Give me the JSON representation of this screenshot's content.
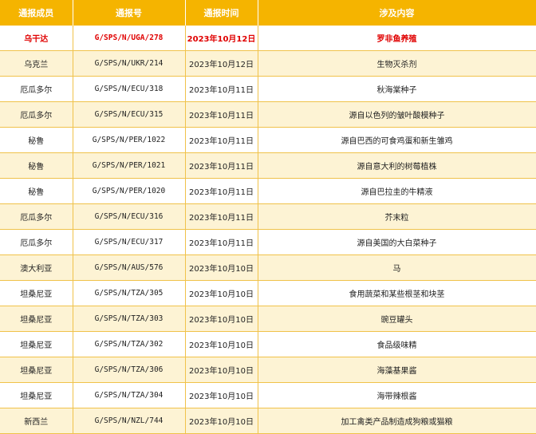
{
  "header": {
    "member": "通报成员",
    "number": "通报号",
    "time": "通报时间",
    "content": "涉及内容"
  },
  "rows": [
    {
      "member": "乌干达",
      "number": "G/SPS/N/UGA/278",
      "time": "2023年10月12日",
      "content": "罗非鱼养殖"
    },
    {
      "member": "乌克兰",
      "number": "G/SPS/N/UKR/214",
      "time": "2023年10月12日",
      "content": "生物灭杀剂"
    },
    {
      "member": "厄瓜多尔",
      "number": "G/SPS/N/ECU/318",
      "time": "2023年10月11日",
      "content": "秋海棠种子"
    },
    {
      "member": "厄瓜多尔",
      "number": "G/SPS/N/ECU/315",
      "time": "2023年10月11日",
      "content": "源自以色列的皱叶酸模种子"
    },
    {
      "member": "秘鲁",
      "number": "G/SPS/N/PER/1022",
      "time": "2023年10月11日",
      "content": "源自巴西的可食鸡蛋和新生雏鸡"
    },
    {
      "member": "秘鲁",
      "number": "G/SPS/N/PER/1021",
      "time": "2023年10月11日",
      "content": "源自意大利的树莓植株"
    },
    {
      "member": "秘鲁",
      "number": "G/SPS/N/PER/1020",
      "time": "2023年10月11日",
      "content": "源自巴拉圭的牛精液"
    },
    {
      "member": "厄瓜多尔",
      "number": "G/SPS/N/ECU/316",
      "time": "2023年10月11日",
      "content": "芥末粒"
    },
    {
      "member": "厄瓜多尔",
      "number": "G/SPS/N/ECU/317",
      "time": "2023年10月11日",
      "content": "源自美国的大白菜种子"
    },
    {
      "member": "澳大利亚",
      "number": "G/SPS/N/AUS/576",
      "time": "2023年10月10日",
      "content": "马"
    },
    {
      "member": "坦桑尼亚",
      "number": "G/SPS/N/TZA/305",
      "time": "2023年10月10日",
      "content": "食用蔬菜和某些根茎和块茎"
    },
    {
      "member": "坦桑尼亚",
      "number": "G/SPS/N/TZA/303",
      "time": "2023年10月10日",
      "content": "豌豆罐头"
    },
    {
      "member": "坦桑尼亚",
      "number": "G/SPS/N/TZA/302",
      "time": "2023年10月10日",
      "content": "食品级味精"
    },
    {
      "member": "坦桑尼亚",
      "number": "G/SPS/N/TZA/306",
      "time": "2023年10月10日",
      "content": "海藻基果酱"
    },
    {
      "member": "坦桑尼亚",
      "number": "G/SPS/N/TZA/304",
      "time": "2023年10月10日",
      "content": "海带辣根酱"
    },
    {
      "member": "新西兰",
      "number": "G/SPS/N/NZL/744",
      "time": "2023年10月10日",
      "content": "加工禽类产品制造成狗粮或猫粮"
    }
  ]
}
